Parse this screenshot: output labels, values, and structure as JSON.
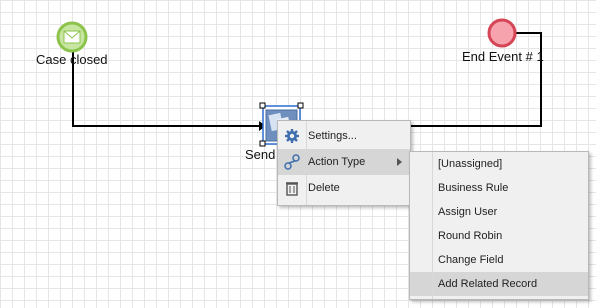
{
  "diagram": {
    "start_event_label": "Case closed",
    "end_event_label": "End Event # 1",
    "task_label": "Send"
  },
  "context_menu": {
    "items": [
      {
        "label": "Settings...",
        "icon": "gear-icon"
      },
      {
        "label": "Action Type",
        "icon": "action-type-icon",
        "submenu": true
      },
      {
        "label": "Delete",
        "icon": "trash-icon"
      }
    ]
  },
  "action_type_menu": {
    "items": [
      {
        "label": "[Unassigned]"
      },
      {
        "label": "Business Rule"
      },
      {
        "label": "Assign User"
      },
      {
        "label": "Round Robin"
      },
      {
        "label": "Change Field"
      },
      {
        "label": "Add Related Record",
        "highlighted": true
      }
    ]
  },
  "colors": {
    "start_event": "#8cc34a",
    "end_event": "#e05a6a",
    "task": "#4f7fbf",
    "selection": "#2e6dd1"
  }
}
